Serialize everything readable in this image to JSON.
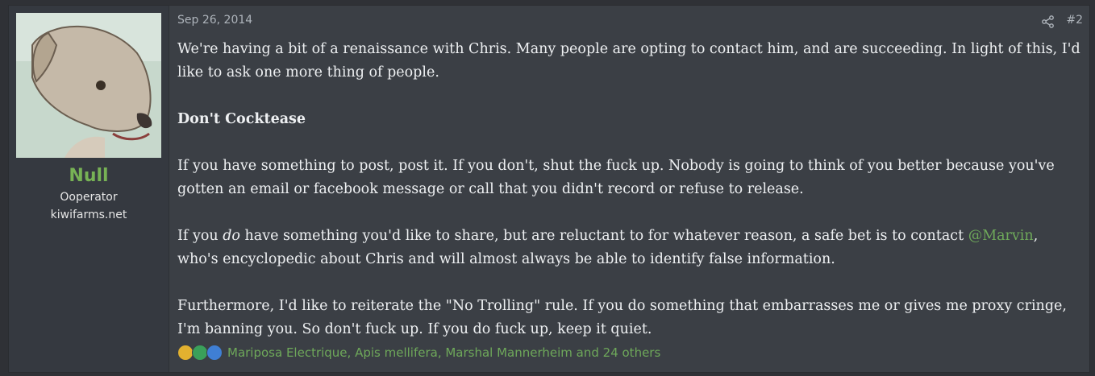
{
  "user": {
    "name": "Null",
    "title": "Ooperator",
    "banner": "kiwifarms.net"
  },
  "post": {
    "date": "Sep 26, 2014",
    "number": "#2",
    "paragraphs": [
      "We're having a bit of a renaissance with Chris. Many people are opting to contact him, and are succeeding. In light of this, I'd like to ask one more thing of people.",
      "Don't Cocktease",
      "If you have something to post, post it. If you don't, shut the fuck up. Nobody is going to think of you better because you've gotten an email or facebook message or call that you didn't record or refuse to release.",
      "If you ",
      "do",
      " have something you'd like to share, but are reluctant to for whatever reason, a safe bet is to contact ",
      "@Marvin",
      ", who's encyclopedic about Chris and will almost always be able to identify false information.",
      "Furthermore, I'd like to reiterate the \"No Trolling\" rule. If you do something that embarrasses me or gives me proxy cringe, I'm banning you. So don't fuck up. If you do fuck up, keep it quiet."
    ]
  },
  "reactions": {
    "icons": [
      "gold-medal-icon",
      "check-icon",
      "thumbs-up-icon"
    ],
    "text": "Mariposa Electrique, Apis mellifera, Marshal Mannerheim and 24 others"
  }
}
